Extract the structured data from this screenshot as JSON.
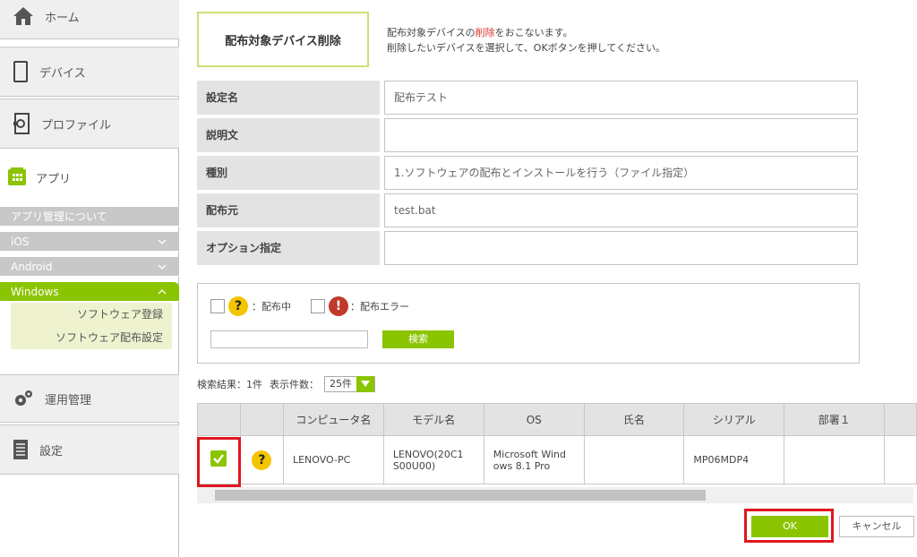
{
  "sidebar": {
    "home": "ホーム",
    "device": "デバイス",
    "profile": "プロファイル",
    "app": "アプリ",
    "app_about": "アプリ管理について",
    "ios": "iOS",
    "android": "Android",
    "windows": "Windows",
    "software_register": "ソフトウェア登録",
    "software_distribute": "ソフトウェア配布設定",
    "operations": "運用管理",
    "settings": "設定"
  },
  "page": {
    "title": "配布対象デバイス削除",
    "desc_line1_pre": "配布対象デバイスの",
    "desc_line1_red": "削除",
    "desc_line1_post": "をおこないます。",
    "desc_line2": "削除したいデバイスを選択して、OKボタンを押してください。"
  },
  "form": [
    {
      "label": "設定名",
      "value": "配布テスト"
    },
    {
      "label": "説明文",
      "value": ""
    },
    {
      "label": "種別",
      "value": "1.ソフトウェアの配布とインストールを行う（ファイル指定）"
    },
    {
      "label": "配布元",
      "value": "test.bat"
    },
    {
      "label": "オプション指定",
      "value": ""
    }
  ],
  "filter": {
    "distributing": "：配布中",
    "error": "：配布エラー",
    "search_button": "検索",
    "search_placeholder": ""
  },
  "results": {
    "count_text": "検索結果：1件",
    "per_page_label": "表示件数：",
    "per_page_value": "25件"
  },
  "table": {
    "headers": [
      "",
      "",
      "コンピュータ名",
      "モデル名",
      "OS",
      "氏名",
      "シリアル",
      "部署１",
      ""
    ],
    "rows": [
      {
        "computer": "LENOVO-PC",
        "model": "LENOVO(20C1 S00U00)",
        "os": "Microsoft Wind ows 8.1 Pro",
        "name": "",
        "serial": "MP06MDP4",
        "dept": ""
      }
    ]
  },
  "buttons": {
    "ok": "OK",
    "cancel": "キャンセル"
  },
  "colors": {
    "accent": "#8bc400",
    "highlight": "#e0161f",
    "label_bg": "#e3e3e3"
  }
}
